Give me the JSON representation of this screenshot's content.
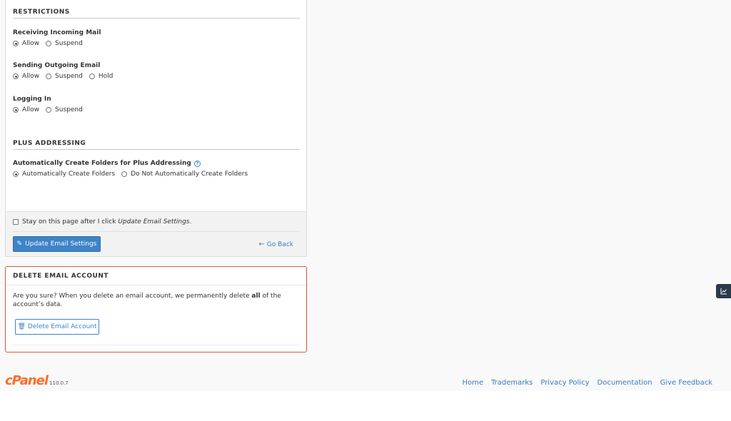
{
  "restrictions": {
    "title": "RESTRICTIONS",
    "incoming": {
      "label": "Receiving Incoming Mail",
      "options": [
        "Allow",
        "Suspend"
      ],
      "selected": "Allow"
    },
    "outgoing": {
      "label": "Sending Outgoing Email",
      "options": [
        "Allow",
        "Suspend",
        "Hold"
      ],
      "selected": "Allow"
    },
    "login": {
      "label": "Logging In",
      "options": [
        "Allow",
        "Suspend"
      ],
      "selected": "Allow"
    }
  },
  "plus": {
    "title": "PLUS ADDRESSING",
    "label": "Automatically Create Folders for Plus Addressing",
    "help_icon": "?",
    "options": [
      "Automatically Create Folders",
      "Do Not Automatically Create Folders"
    ],
    "selected": "Automatically Create Folders"
  },
  "form_footer": {
    "stay_prefix": "Stay on this page after I click ",
    "stay_emphasis": "Update Email Settings",
    "stay_suffix": ".",
    "update_button": "Update Email Settings",
    "go_back": "Go Back"
  },
  "delete": {
    "title": "DELETE EMAIL ACCOUNT",
    "text_before": "Are you sure? When you delete an email account, we permanently delete ",
    "text_bold": "all",
    "text_after": " of the account’s data.",
    "button": "Delete Email Account"
  },
  "footer": {
    "logo": "cPanel",
    "version": "110.0.7",
    "links": [
      "Home",
      "Trademarks",
      "Privacy Policy",
      "Documentation",
      "Give Feedback"
    ]
  },
  "colors": {
    "accent": "#3e83c8",
    "danger": "#d9583b",
    "brand": "#ff6c2c"
  }
}
